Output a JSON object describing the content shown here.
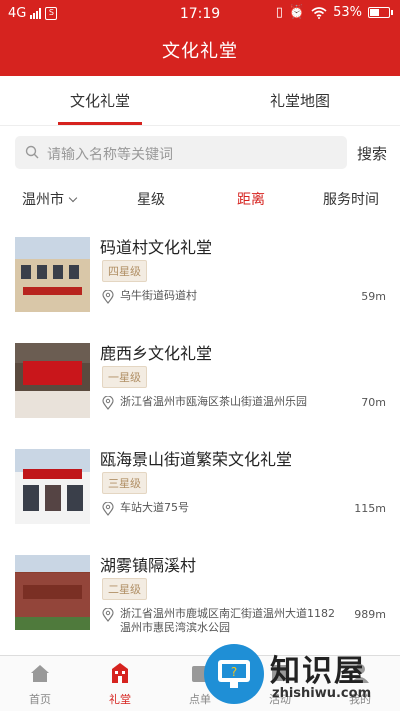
{
  "status_bar": {
    "network": "4G",
    "time": "17:19",
    "battery": "53%",
    "battery_level": 0.53
  },
  "header": {
    "title": "文化礼堂"
  },
  "tabs": [
    {
      "label": "文化礼堂",
      "active": true
    },
    {
      "label": "礼堂地图",
      "active": false
    }
  ],
  "search": {
    "placeholder": "请输入名称等关键词",
    "button_label": "搜索"
  },
  "filters": [
    {
      "label": "温州市",
      "dropdown": true,
      "active": false
    },
    {
      "label": "星级",
      "active": false
    },
    {
      "label": "距离",
      "active": true
    },
    {
      "label": "服务时间",
      "active": false
    }
  ],
  "list": [
    {
      "name": "码道村文化礼堂",
      "badge": "四星级",
      "address": "乌牛街道码道村",
      "distance": "59m"
    },
    {
      "name": "鹿西乡文化礼堂",
      "badge": "一星级",
      "address": "浙江省温州市瓯海区茶山街道温州乐园",
      "distance": "70m"
    },
    {
      "name": "瓯海景山街道繁荣文化礼堂",
      "badge": "三星级",
      "address": "车站大道75号",
      "distance": "115m"
    },
    {
      "name": "湖雾镇隔溪村",
      "badge": "二星级",
      "address": "浙江省温州市鹿城区南汇街道温州大道1182温州市惠民湾滨水公园",
      "distance": "989m"
    }
  ],
  "bottom_nav": [
    {
      "label": "首页",
      "icon": "home-icon",
      "active": false
    },
    {
      "label": "礼堂",
      "icon": "hall-icon",
      "active": true
    },
    {
      "label": "点单",
      "icon": "order-icon",
      "active": false
    },
    {
      "label": "活动",
      "icon": "activity-icon",
      "active": false
    },
    {
      "label": "我的",
      "icon": "user-icon",
      "active": false
    }
  ],
  "watermark": {
    "title": "知识屋",
    "url": "zhishiwu.com"
  },
  "colors": {
    "accent": "#d6231f",
    "badge_text": "#b19066",
    "badge_bg": "#f3ece2"
  }
}
